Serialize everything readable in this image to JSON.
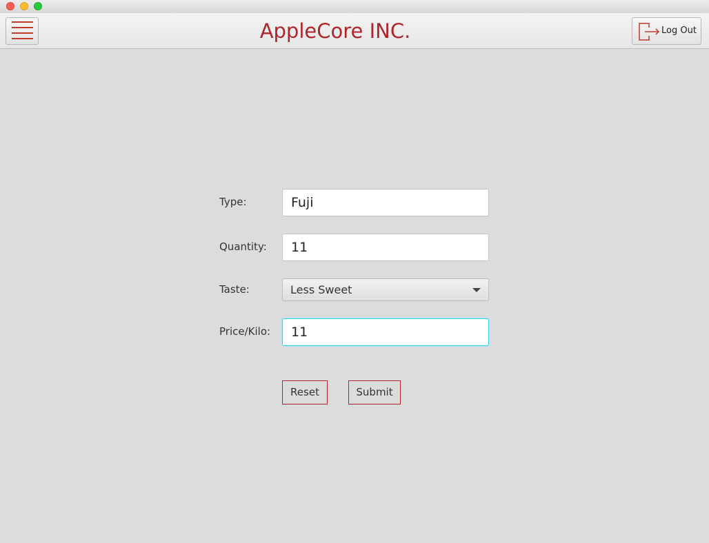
{
  "header": {
    "title": "AppleCore INC.",
    "logout_label": "Log Out",
    "menu_icon": "hamburger-icon",
    "logout_icon": "logout-icon",
    "accent_color": "#b0252b"
  },
  "form": {
    "type": {
      "label": "Type:",
      "value": "Fuji"
    },
    "quantity": {
      "label": "Quantity:",
      "value": "11"
    },
    "taste": {
      "label": "Taste:",
      "selected": "Less Sweet"
    },
    "price": {
      "label": "Price/Kilo:",
      "value": "11"
    }
  },
  "actions": {
    "reset_label": "Reset",
    "submit_label": "Submit"
  }
}
